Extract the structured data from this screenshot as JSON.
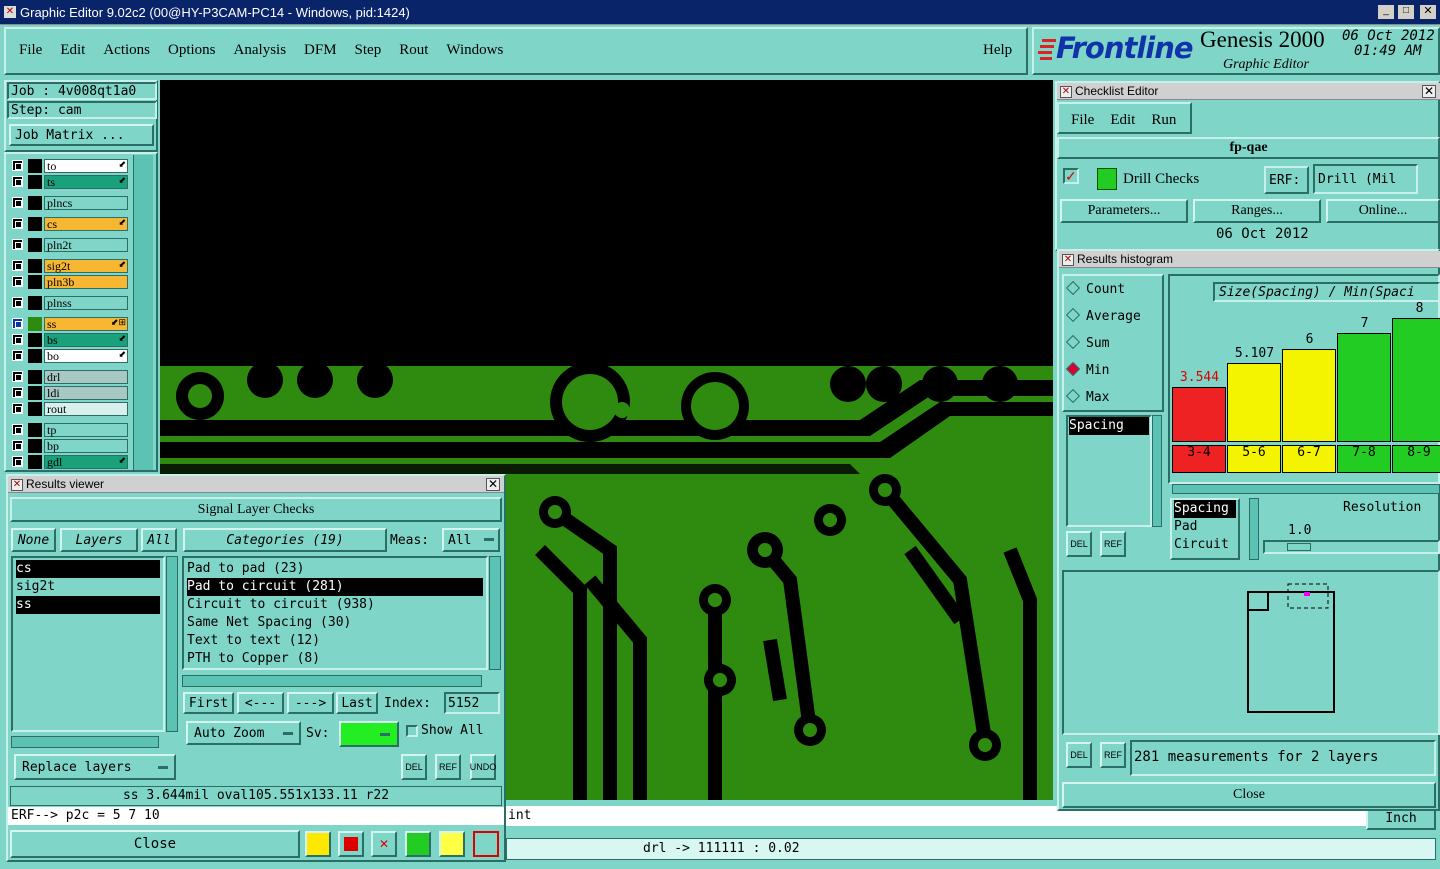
{
  "window": {
    "title": "Graphic Editor 9.02c2 (00@HY-P3CAM-PC14 - Windows, pid:1424)"
  },
  "menu": [
    "File",
    "Edit",
    "Actions",
    "Options",
    "Analysis",
    "DFM",
    "Step",
    "Rout",
    "Windows"
  ],
  "help": "Help",
  "brand": {
    "logo": "Frontline",
    "product": "Genesis 2000",
    "subtitle": "Graphic Editor",
    "date": "06 Oct 2012",
    "time": "01:49 AM"
  },
  "job": {
    "job": "Job : 4v008qt1a0",
    "step": "Step: cam",
    "matrix": "Job Matrix ..."
  },
  "layers": [
    {
      "name": "to",
      "color": "#ffffff",
      "mark": "⬋"
    },
    {
      "name": "ts",
      "color": "#1aa07a",
      "mark": "⬋"
    },
    {
      "name": "plncs",
      "color": "#7fd6c8",
      "mark": ""
    },
    {
      "name": "cs",
      "color": "#f7b733",
      "mark": "⬋"
    },
    {
      "name": "pln2t",
      "color": "#7fd6c8",
      "mark": ""
    },
    {
      "name": "sig2t",
      "color": "#f7b733",
      "mark": "⬋"
    },
    {
      "name": "pln3b",
      "color": "#f7b733",
      "mark": ""
    },
    {
      "name": "plnss",
      "color": "#7fd6c8",
      "mark": ""
    },
    {
      "name": "ss",
      "color": "#f7b733",
      "mark": "⬋⊞"
    },
    {
      "name": "bs",
      "color": "#1aa07a",
      "mark": "⬋"
    },
    {
      "name": "bo",
      "color": "#ffffff",
      "mark": "⬋"
    },
    {
      "name": "drl",
      "color": "#a8c8c4",
      "mark": ""
    },
    {
      "name": "ldi",
      "color": "#a8c8c4",
      "mark": ""
    },
    {
      "name": "rout",
      "color": "#d8f0ec",
      "mark": ""
    },
    {
      "name": "tp",
      "color": "#7fd6c8",
      "mark": ""
    },
    {
      "name": "bp",
      "color": "#7fd6c8",
      "mark": ""
    },
    {
      "name": "gdl",
      "color": "#1aa07a",
      "mark": "⬋"
    }
  ],
  "results_viewer": {
    "title": "Results viewer",
    "heading": "Signal Layer Checks",
    "none": "None",
    "layers": "Layers",
    "all": "All",
    "categories_btn": "Categories (19)",
    "meas_label": "Meas:",
    "meas_value": "All",
    "layer_list": [
      {
        "name": "cs",
        "sel": true
      },
      {
        "name": "sig2t",
        "sel": false
      },
      {
        "name": "ss",
        "sel": true
      }
    ],
    "categories": [
      {
        "name": "Pad to pad (23)",
        "sel": false
      },
      {
        "name": "Pad to circuit (281)",
        "sel": true
      },
      {
        "name": "Circuit to circuit (938)",
        "sel": false
      },
      {
        "name": "Same Net Spacing (30)",
        "sel": false
      },
      {
        "name": "Text to text (12)",
        "sel": false
      },
      {
        "name": "PTH to Copper (8)",
        "sel": false
      }
    ],
    "first": "First",
    "prev": "<---",
    "next": "--->",
    "last": "Last",
    "index_label": "Index:",
    "index_value": "5152",
    "auto_zoom": "Auto Zoom",
    "sv_label": "Sv:",
    "show_all": "Show All",
    "replace_layers": "Replace layers",
    "status": "ss 3.644mil   oval105.551x133.11   r22",
    "erf": "ERF--> p2c = 5 7 10",
    "close": "Close",
    "del": "DEL",
    "ref": "REF",
    "undo": "UNDO"
  },
  "checklist": {
    "title": "Checklist Editor",
    "menu": [
      "File",
      "Edit",
      "Run"
    ],
    "name": "fp-qae",
    "check": "Drill Checks",
    "erf_label": "ERF:",
    "erf_value": "Drill (Mil",
    "parameters": "Parameters...",
    "ranges": "Ranges...",
    "online": "Online...",
    "date": "06 Oct 2012"
  },
  "histogram": {
    "title": "Results histogram",
    "modes": [
      {
        "name": "Count",
        "sel": false
      },
      {
        "name": "Average",
        "sel": false
      },
      {
        "name": "Sum",
        "sel": false
      },
      {
        "name": "Min",
        "sel": true
      },
      {
        "name": "Max",
        "sel": false
      }
    ],
    "header": "Size(Spacing) / Min(Spaci",
    "meas_list": [
      "Spacing"
    ],
    "type_list": [
      "Spacing",
      "Pad",
      "Circuit"
    ],
    "resolution_label": "Resolution",
    "resolution_value": "1.0",
    "summary": "281 measurements for 2 layers",
    "close": "Close"
  },
  "chart_data": {
    "type": "bar",
    "title": "Size(Spacing) / Min(Spaci",
    "categories": [
      "3-4",
      "5-6",
      "6-7",
      "7-8",
      "8-9"
    ],
    "values": [
      3.544,
      5.107,
      6,
      7,
      8
    ],
    "value_labels": [
      "3.544",
      "5.107",
      "6",
      "7",
      "8"
    ],
    "colors": [
      "#ee2222",
      "#f4f400",
      "#f4f400",
      "#22cc22",
      "#22cc22"
    ]
  },
  "bottom": {
    "prompt": "int",
    "units": "Inch",
    "drl": "drl -> 111111 : 0.02"
  }
}
